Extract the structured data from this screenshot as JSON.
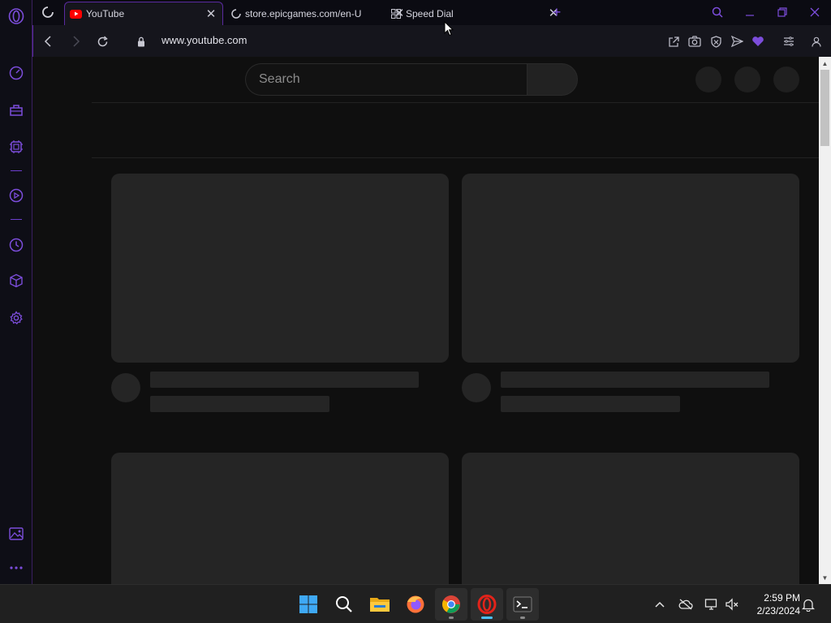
{
  "browser": {
    "tabs": [
      {
        "title": "YouTube",
        "active": true
      },
      {
        "title": "store.epicgames.com/en-U",
        "active": false
      },
      {
        "title": "Speed Dial",
        "active": false
      }
    ],
    "url": "www.youtube.com",
    "accent_color": "#7c4ddb",
    "sidebar_icons": [
      "opera-logo-icon",
      "speed-dial-icon",
      "shopping-icon",
      "aria-icon",
      "player-icon",
      "history-icon",
      "extensions-icon",
      "settings-icon",
      "gallery-icon",
      "more-icon"
    ]
  },
  "page": {
    "search_placeholder": "Search",
    "state": "loading-skeleton"
  },
  "taskbar": {
    "apps": [
      "windows-start",
      "search",
      "file-explorer",
      "firefox",
      "chrome",
      "opera",
      "terminal"
    ],
    "time": "2:59 PM",
    "date": "2/23/2024"
  }
}
